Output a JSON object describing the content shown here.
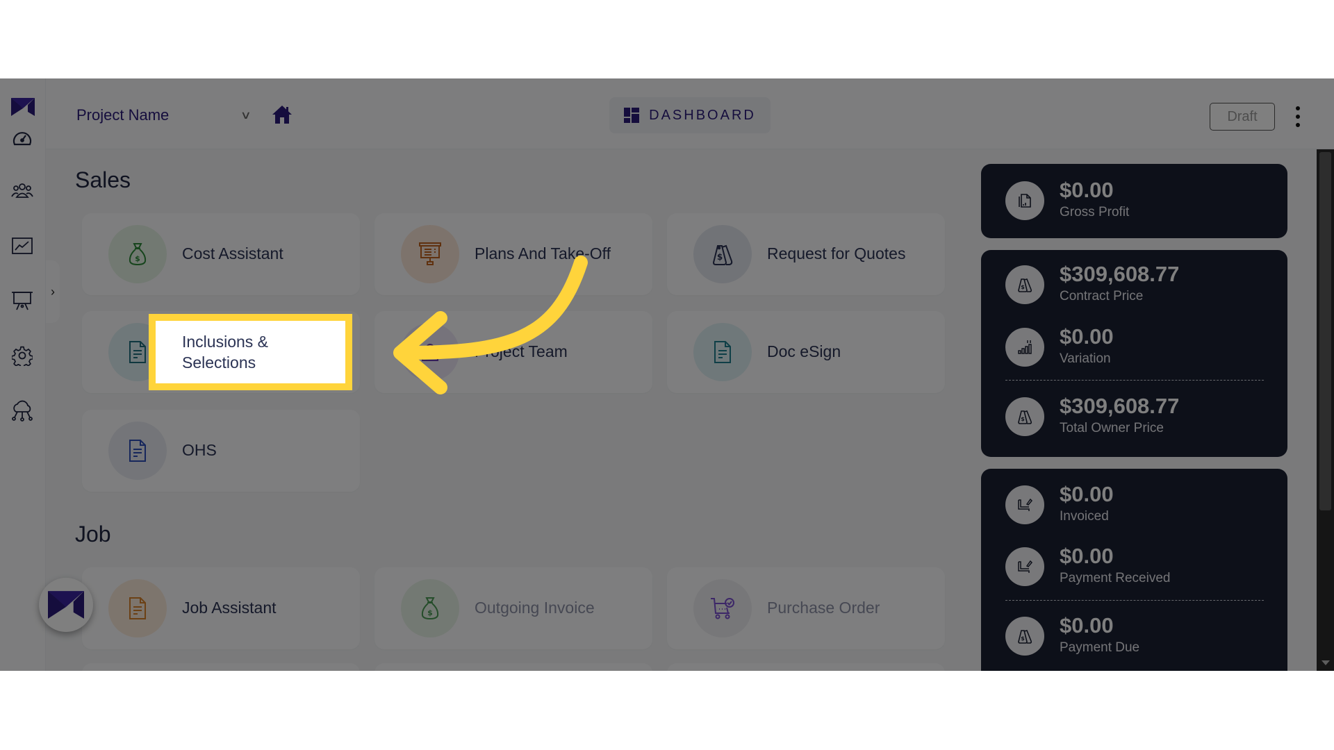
{
  "app": {
    "brand_icon": "m-logo-icon",
    "colors": {
      "brand": "#2a1a7a",
      "stat_card_bg": "#1b2033",
      "highlight": "#ffd43b",
      "overlay": "rgba(0,0,0,0.5)"
    }
  },
  "sidebar": {
    "items": [
      {
        "icon": "speedometer-icon",
        "label": "Dashboard"
      },
      {
        "icon": "team-icon",
        "label": "Contacts"
      },
      {
        "icon": "line-chart-icon",
        "label": "Reports"
      },
      {
        "icon": "presentation-board-icon",
        "label": "Presentations"
      },
      {
        "icon": "gear-icon",
        "label": "Settings"
      },
      {
        "icon": "cloud-network-icon",
        "label": "Integrations"
      }
    ],
    "expand_icon": "chevron-right-icon"
  },
  "header": {
    "project_select": {
      "value": "Project Name",
      "icon": "chevron-down-icon"
    },
    "home_icon": "home-icon",
    "tab": {
      "label": "DASHBOARD",
      "icon": "dashboard-grid-icon"
    },
    "status_button": "Draft",
    "more_icon": "kebab-menu-icon"
  },
  "sales": {
    "title": "Sales",
    "tiles": [
      {
        "label": "Cost Assistant",
        "icon": "money-bag-icon",
        "color": "#2e8b3a",
        "bg": "#e4f3e4"
      },
      {
        "label": "Plans And Take-Off",
        "icon": "presentation-board-icon",
        "color": "#c0621e",
        "bg": "#fbe7d9"
      },
      {
        "label": "Request for Quotes",
        "icon": "price-tags-icon",
        "color": "#2b3354",
        "bg": "#e3e6ee"
      },
      {
        "label": "Inclusions & Selections",
        "icon": "document-icon",
        "color": "#1f6f7f",
        "bg": "#dff0f4"
      },
      {
        "label": "Project Team",
        "icon": "team-icon",
        "color": "#6a3fb0",
        "bg": "#ece6f6"
      },
      {
        "label": "Doc eSign",
        "icon": "document-icon",
        "color": "#1f7f8f",
        "bg": "#dff0f4"
      },
      {
        "label": "OHS",
        "icon": "document-icon",
        "color": "#2f4fb8",
        "bg": "#e8ebf3"
      }
    ]
  },
  "job": {
    "title": "Job",
    "tiles": [
      {
        "label": "Job Assistant",
        "icon": "document-icon",
        "color": "#d9822b",
        "bg": "#fbeadb"
      },
      {
        "label": "Outgoing Invoice",
        "icon": "money-bag-icon",
        "color": "#4a9a55",
        "bg": "#e6f2e6"
      },
      {
        "label": "Purchase Order",
        "icon": "shopping-cart-check-icon",
        "color": "#7a4fd0",
        "bg": "#eeeef2"
      }
    ]
  },
  "stats": {
    "gross": [
      {
        "value": "$0.00",
        "label": "Gross Profit",
        "icon": "document-chart-icon"
      }
    ],
    "contract": [
      {
        "value": "$309,608.77",
        "label": "Contract Price",
        "icon": "price-tags-icon"
      },
      {
        "value": "$0.00",
        "label": "Variation",
        "icon": "bar-chart-arrows-icon"
      },
      {
        "value": "$309,608.77",
        "label": "Total Owner Price",
        "icon": "price-tags-icon"
      }
    ],
    "payments": [
      {
        "value": "$0.00",
        "label": "Invoiced",
        "icon": "invoice-sign-icon"
      },
      {
        "value": "$0.00",
        "label": "Payment Received",
        "icon": "invoice-sign-icon"
      },
      {
        "value": "$0.00",
        "label": "Payment Due",
        "icon": "price-tags-icon"
      }
    ]
  },
  "annotation": {
    "highlight_target": "Inclusions & Selections",
    "arrow_icon": "curved-arrow-icon"
  },
  "floating_button": {
    "icon": "m-logo-icon"
  }
}
